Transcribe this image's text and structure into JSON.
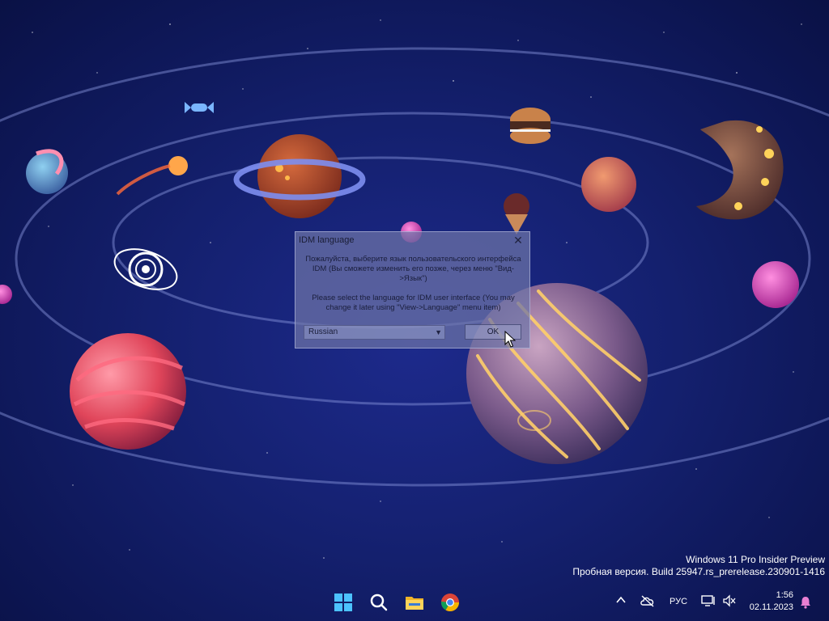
{
  "dialog": {
    "title": "IDM language",
    "close_glyph": "✕",
    "text_ru": "Пожалуйста, выберите язык пользовательского интерфейса IDM (Вы сможете изменить его позже, через меню \"Вид->Язык\")",
    "text_en": "Please select the language for IDM user interface (You may change it later using \"View->Language\" menu item)",
    "language_value": "Russian",
    "ok_label": "OK"
  },
  "watermark": {
    "line1": "Windows 11 Pro Insider Preview",
    "line2": "Пробная версия. Build 25947.rs_prerelease.230901-1416"
  },
  "taskbar": {
    "pinned": [
      "windows-start-icon",
      "search-icon",
      "file-explorer-icon",
      "chrome-icon"
    ],
    "tray_language": "РУС",
    "time": "1:56",
    "date": "02.11.2023"
  },
  "colors": {
    "wallpaper_bg": "#14206e",
    "accent_bell": "#e97fd3"
  }
}
